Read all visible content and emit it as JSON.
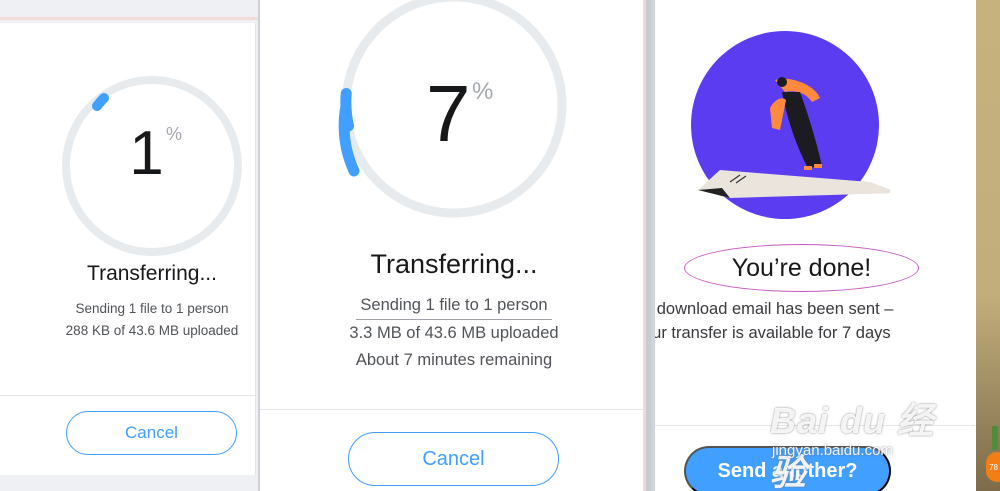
{
  "panel1": {
    "percent_value": "1",
    "percent_symbol": "%",
    "progress": 0.01,
    "title": "Transferring...",
    "line1": "Sending 1 file to 1 person",
    "line2": "288 KB of 43.6 MB uploaded",
    "cancel_label": "Cancel"
  },
  "panel2": {
    "percent_value": "7",
    "percent_symbol": "%",
    "progress": 0.07,
    "title": "Transferring...",
    "line1": "Sending 1 file to 1 person",
    "line2": "3.3 MB of 43.6 MB uploaded",
    "line3": "About 7 minutes remaining",
    "cancel_label": "Cancel"
  },
  "panel3": {
    "title": "You’re done!",
    "line1": "e download email has been sent –",
    "line2": "our transfer is available for 7 days",
    "send_label": "Send another?"
  },
  "watermark": {
    "main": "Bai du 经验",
    "sub": "jingyan.baidu.com"
  },
  "badge": {
    "text": "78"
  },
  "colors": {
    "accent": "#409fff",
    "ring_track": "#e8ebee",
    "illustration_purple": "#5b3cf0",
    "ellipse": "#c859c4"
  }
}
